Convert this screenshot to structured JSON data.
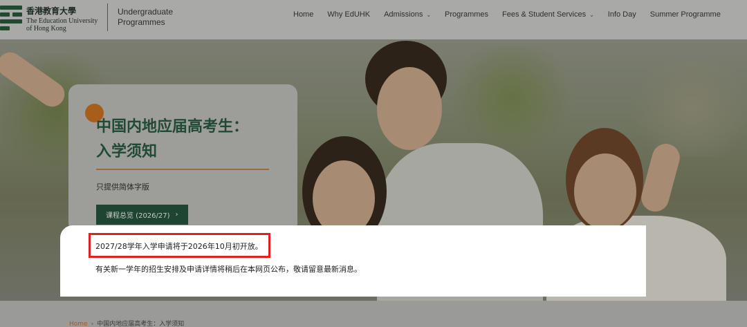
{
  "header": {
    "logo": {
      "zh": "香港教育大學",
      "en_line1": "The Education University",
      "en_line2": "of Hong Kong"
    },
    "site_name_line1": "Undergraduate",
    "site_name_line2": "Programmes",
    "nav": [
      {
        "label": "Home",
        "has_dropdown": false
      },
      {
        "label": "Why EdUHK",
        "has_dropdown": false
      },
      {
        "label": "Admissions",
        "has_dropdown": true
      },
      {
        "label": "Programmes",
        "has_dropdown": false
      },
      {
        "label": "Fees & Student Services",
        "has_dropdown": true
      },
      {
        "label": "Info Day",
        "has_dropdown": false
      },
      {
        "label": "Summer Programme",
        "has_dropdown": false
      }
    ]
  },
  "hero_card": {
    "title_line1": "中国内地应届高考生：",
    "title_line2": "入学须知",
    "note": "只提供简体字版",
    "button_label": "课程总览 (2026/27)",
    "button_icon": "chevron-right-icon"
  },
  "notice": {
    "headline": "2027/28学年入学申请将于2026年10月初开放。",
    "detail": "有关新一学年的招生安排及申请详情将稍后在本网页公布，敬请留意最新消息。"
  },
  "breadcrumb": {
    "home": "Home",
    "current": "中国内地应届高考生：入学须知"
  },
  "colors": {
    "brand_green": "#1e4531",
    "accent_orange": "#a75e1a",
    "highlight_red": "#e02124"
  }
}
